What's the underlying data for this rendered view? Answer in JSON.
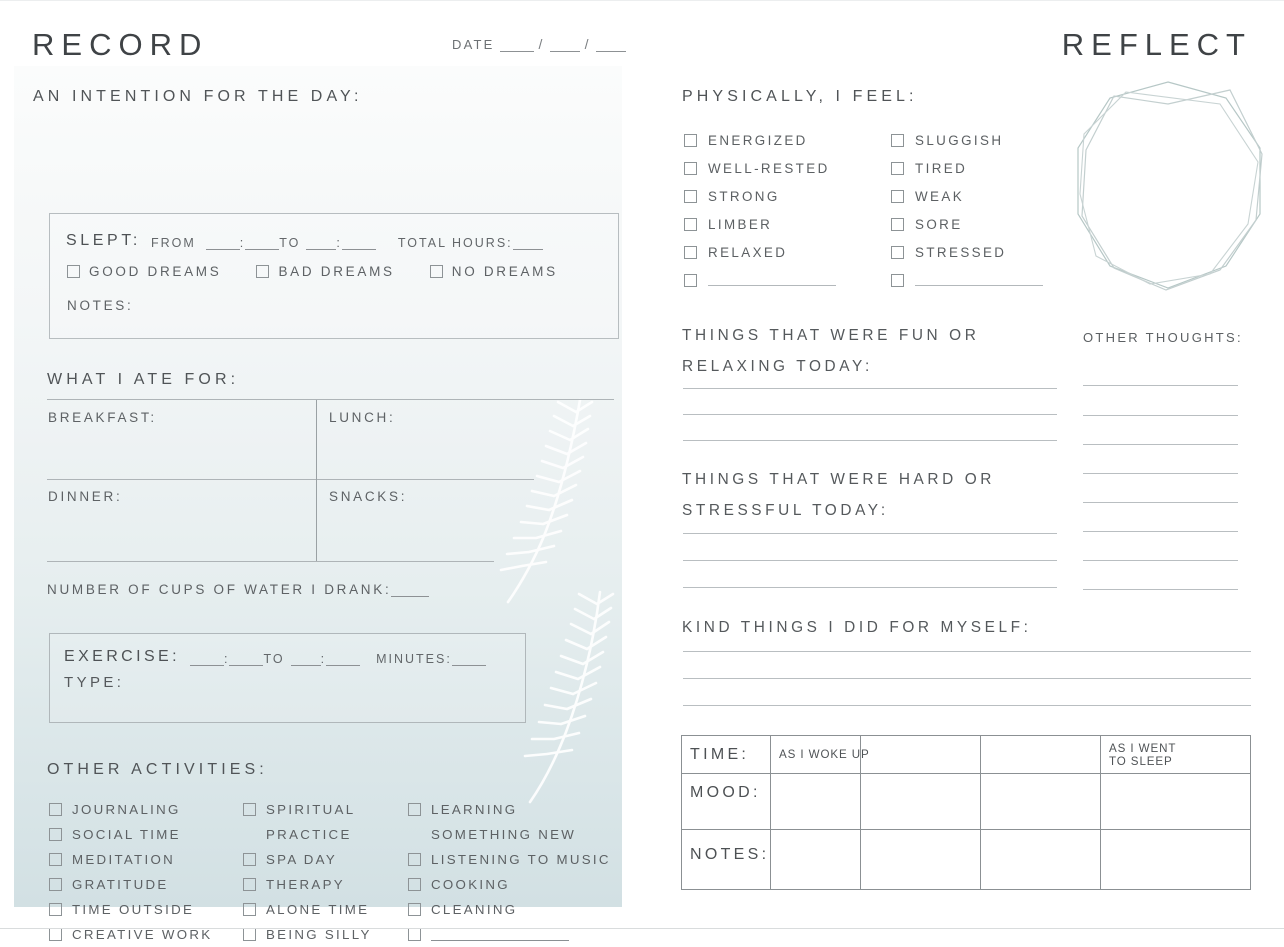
{
  "page": {
    "left_title": "RECORD",
    "right_title": "REFLECT",
    "date_label": "DATE"
  },
  "record": {
    "intention_label": "AN INTENTION FOR THE DAY:",
    "sleep": {
      "slept_label": "SLEPT:",
      "from_label": "FROM",
      "to_label": "TO",
      "colon": ":",
      "total_hours_label": "TOTAL HOURS:",
      "notes_label": "NOTES:",
      "dream_options": [
        "GOOD DREAMS",
        "BAD DREAMS",
        "NO DREAMS"
      ]
    },
    "food": {
      "heading": "WHAT I ATE FOR:",
      "meals": [
        "BREAKFAST:",
        "LUNCH:",
        "DINNER:",
        "SNACKS:"
      ]
    },
    "water_label": "NUMBER OF CUPS OF WATER I DRANK:",
    "exercise": {
      "exercise_label": "EXERCISE:",
      "to_label": "TO",
      "colon": ":",
      "minutes_label": "MINUTES:",
      "type_label": "TYPE:"
    },
    "activities": {
      "heading": "OTHER ACTIVITIES:",
      "column_1": [
        "JOURNALING",
        "SOCIAL TIME",
        "MEDITATION",
        "GRATITUDE",
        "TIME OUTSIDE",
        "CREATIVE WORK"
      ],
      "column_2_first": "SPIRITUAL",
      "column_2_first_cont": "PRACTICE",
      "column_2_rest": [
        "SPA DAY",
        "THERAPY",
        "ALONE TIME",
        "BEING SILLY"
      ],
      "column_3_first": "LEARNING",
      "column_3_first_cont": "SOMETHING NEW",
      "column_3_rest": [
        "LISTENING TO MUSIC",
        "COOKING",
        "CLEANING"
      ],
      "column_3_blank": ""
    }
  },
  "reflect": {
    "physical_heading": "PHYSICALLY, I FEEL:",
    "physical_left": [
      "ENERGIZED",
      "WELL-RESTED",
      "STRONG",
      "LIMBER",
      "RELAXED"
    ],
    "physical_right": [
      "SLUGGISH",
      "TIRED",
      "WEAK",
      "SORE",
      "STRESSED"
    ],
    "fun_heading_line1": "THINGS THAT WERE FUN OR",
    "fun_heading_line2": "RELAXING TODAY:",
    "hard_heading_line1": "THINGS THAT WERE HARD OR",
    "hard_heading_line2": "STRESSFUL TODAY:",
    "kind_heading": "KIND THINGS I DID FOR MYSELF:",
    "other_thoughts_heading": "OTHER THOUGHTS:",
    "mood_table": {
      "row_labels": [
        "TIME:",
        "MOOD:",
        "NOTES:"
      ],
      "column_headers": [
        "AS I WOKE UP",
        "",
        "",
        "AS I WENT\nTO SLEEP"
      ],
      "col_header_first": "AS I WOKE UP",
      "col_header_last_line1": "AS I WENT",
      "col_header_last_line2": "TO SLEEP"
    }
  },
  "colors": {
    "panel_top": "#fbfcfc",
    "panel_bottom": "#d2e0e3",
    "ink": "#5a5e61",
    "rule": "#b9bec1",
    "polygon_stroke": "#b8c9c8"
  }
}
